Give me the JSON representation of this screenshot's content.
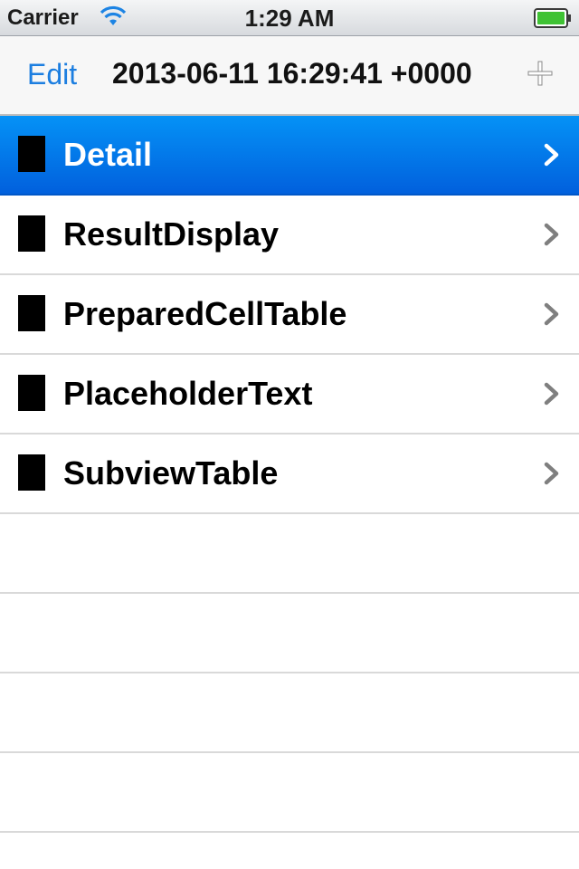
{
  "status_bar": {
    "carrier": "Carrier",
    "time": "1:29 AM",
    "wifi_icon": "wifi-icon",
    "battery_icon": "battery-icon",
    "battery_color": "#3fc234"
  },
  "nav_bar": {
    "edit_label": "Edit",
    "title": "2013-06-11 16:29:41 +0000",
    "add_icon": "plus-icon"
  },
  "table": {
    "rows": [
      {
        "label": "Detail",
        "selected": true
      },
      {
        "label": "ResultDisplay",
        "selected": false
      },
      {
        "label": "PreparedCellTable",
        "selected": false
      },
      {
        "label": "PlaceholderText",
        "selected": false
      },
      {
        "label": "SubviewTable",
        "selected": false
      }
    ],
    "accessory_icon": "chevron-right-icon"
  },
  "colors": {
    "tint": "#1c7ee0",
    "selection": "#0278ec",
    "separator": "#d9d9d9"
  }
}
